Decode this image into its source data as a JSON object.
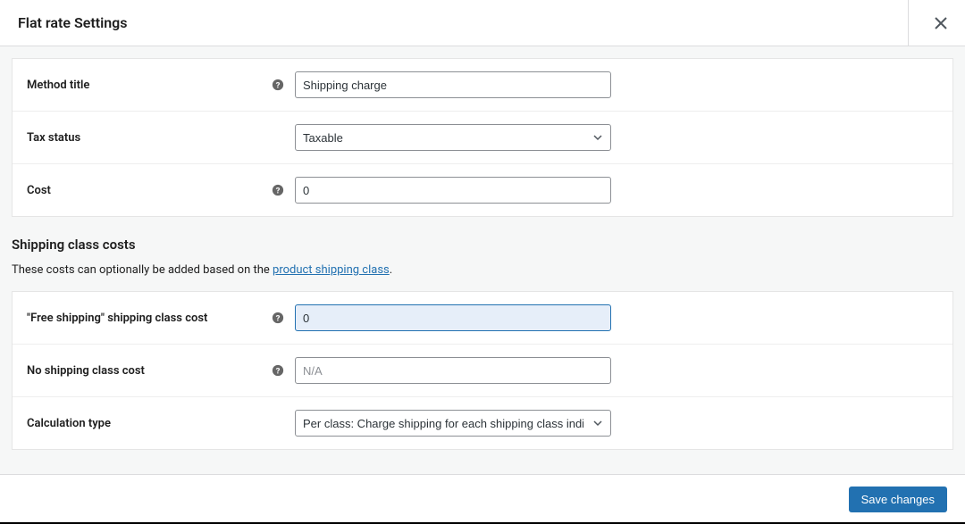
{
  "header": {
    "title": "Flat rate Settings"
  },
  "form1": {
    "method_title": {
      "label": "Method title",
      "value": "Shipping charge"
    },
    "tax_status": {
      "label": "Tax status",
      "selected": "Taxable"
    },
    "cost": {
      "label": "Cost",
      "value": "0"
    }
  },
  "section": {
    "title": "Shipping class costs",
    "desc_prefix": "These costs can optionally be added based on the ",
    "desc_link": "product shipping class",
    "desc_suffix": "."
  },
  "form2": {
    "free_shipping_cost": {
      "label": "\"Free shipping\" shipping class cost",
      "value": "0"
    },
    "no_shipping_cost": {
      "label": "No shipping class cost",
      "placeholder": "N/A",
      "value": ""
    },
    "calculation_type": {
      "label": "Calculation type",
      "selected": "Per class: Charge shipping for each shipping class individually"
    }
  },
  "footer": {
    "save_label": "Save changes"
  }
}
